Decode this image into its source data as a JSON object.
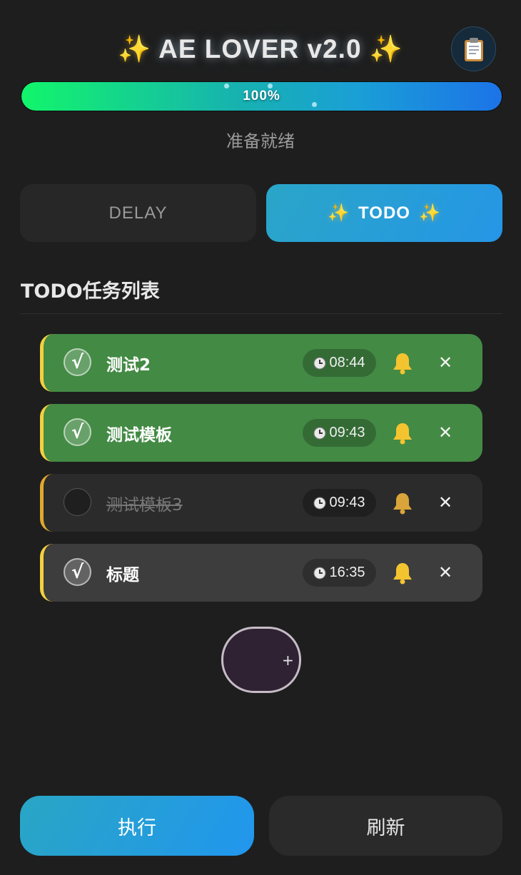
{
  "header": {
    "spark_left": "✨",
    "title": "AE LOVER v2.0",
    "spark_right": "✨",
    "clipboard_icon": "clipboard-icon"
  },
  "progress": {
    "percent": 100,
    "label": "100%"
  },
  "status_text": "准备就绪",
  "tabs": [
    {
      "label": "DELAY",
      "active": false
    },
    {
      "label": "TODO",
      "spark": "✨",
      "active": true
    }
  ],
  "section_title": "TODO任务列表",
  "todos": [
    {
      "title": "测试2",
      "time": "08:44",
      "done": true
    },
    {
      "title": "测试模板",
      "time": "09:43",
      "done": true
    },
    {
      "title": "测试模板3",
      "time": "09:43",
      "done": false
    },
    {
      "title": "标题",
      "time": "16:35",
      "done": true
    }
  ],
  "check_mark": "√",
  "close_glyph": "✕",
  "add_button": {
    "label": "+"
  },
  "actions": {
    "execute_label": "执行",
    "refresh_label": "刷新"
  },
  "colors": {
    "accent": "#2596e6",
    "done_green": "#438a44",
    "bell_yellow": "#f4c430",
    "left_bar_yellow": "#f4d03f"
  }
}
